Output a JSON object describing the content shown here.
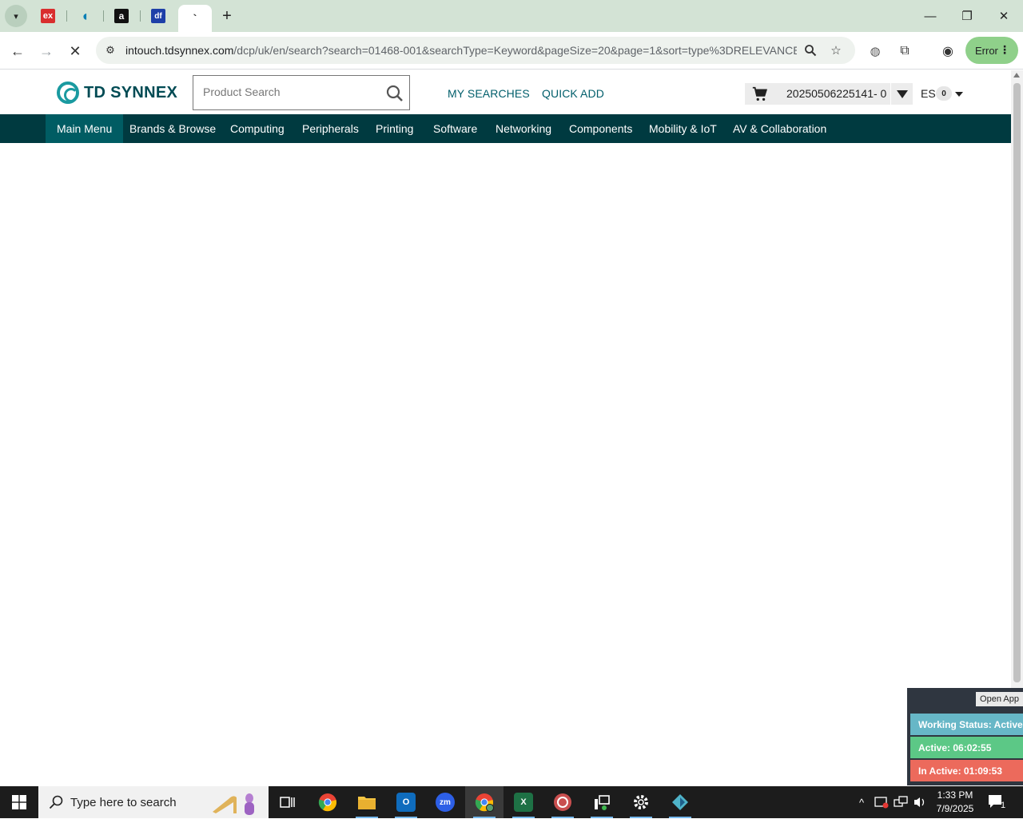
{
  "browser": {
    "tabs": [
      {
        "icon": "expedia-favicon-icon",
        "glyph": "ex",
        "color": "#d92e2e"
      },
      {
        "icon": "teal-app-favicon-icon",
        "glyph": "◖",
        "color": "#0a7fb5"
      },
      {
        "icon": "amazon-favicon-icon",
        "glyph": "a",
        "color": "#111111"
      },
      {
        "icon": "df-favicon-icon",
        "glyph": "df",
        "color": "#1d3fa8"
      },
      {
        "icon": "loading-favicon-icon",
        "glyph": "`",
        "color": "#ffffff",
        "active": true
      }
    ],
    "url_host": "intouch.tdsynnex.com",
    "url_path": "/dcp/uk/en/search?search=01468-001&searchType=Keyword&pageSize=20&page=1&sort=type%3DRELEVANCE",
    "profile_label": "Error"
  },
  "site": {
    "logo_text": "TD SYNNEX",
    "search_placeholder": "Product Search",
    "links": [
      "MY SEARCHES",
      "QUICK ADD"
    ],
    "cart_number": "20250506225141- 0",
    "language": "ES",
    "language_count": "0",
    "nav": [
      "Main Menu",
      "Brands & Browse",
      "Computing",
      "Peripherals",
      "Printing",
      "Software",
      "Networking",
      "Components",
      "Mobility & IoT",
      "AV & Collaboration"
    ],
    "active_nav": "Main Menu"
  },
  "widget": {
    "open_app": "Open App",
    "working_status": "Working Status: Active",
    "active_time": "Active: 06:02:55",
    "inactive_time": "In Active: 01:09:53"
  },
  "taskbar": {
    "search_placeholder": "Type here to search",
    "time": "1:33 PM",
    "date": "7/9/2025",
    "notification_count": "1",
    "colors": {
      "chrome": "#ea4335",
      "explorer": "#f5c542",
      "outlook": "#0f6cbd",
      "zoom": "#2d5fe6",
      "excel": "#1e7145",
      "settings": "#ffffff"
    }
  }
}
